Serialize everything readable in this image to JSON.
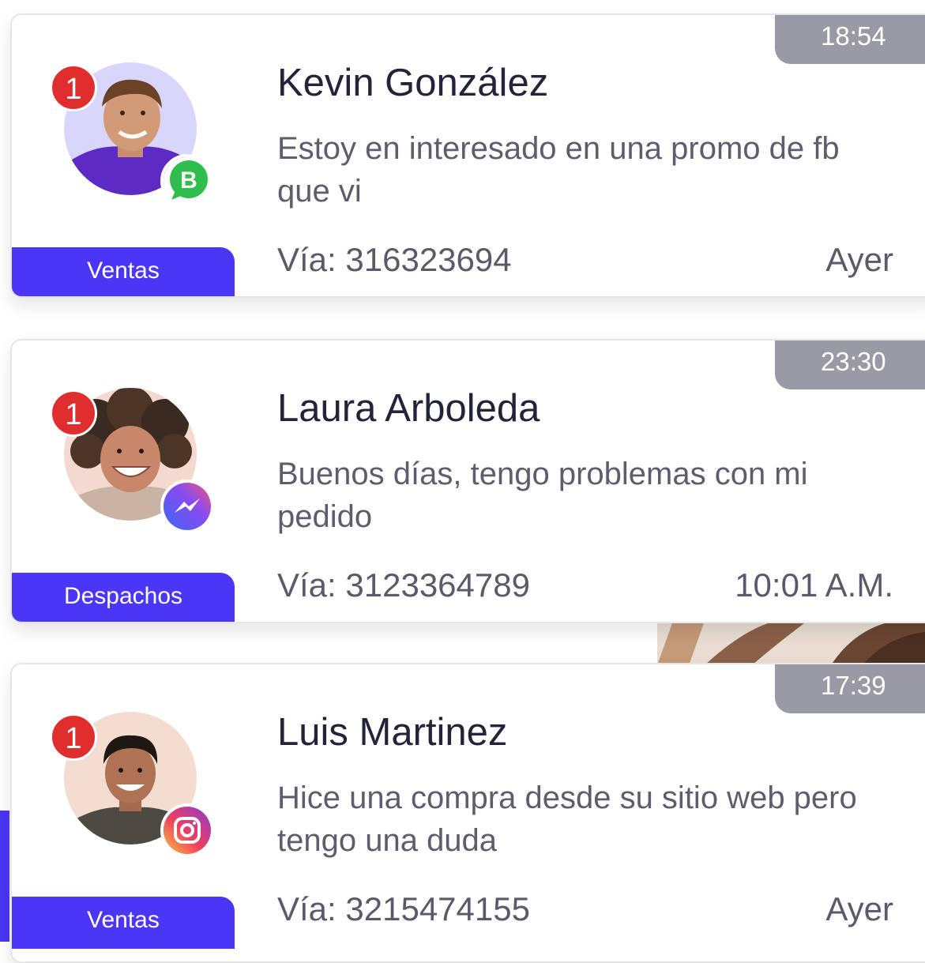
{
  "conversations": [
    {
      "time": "18:54",
      "unread": "1",
      "name": "Kevin González",
      "message": "Estoy en interesado en una promo de fb que vi",
      "via": "Vía: 316323694",
      "when": "Ayer",
      "department": "Ventas",
      "channel_icon": "whatsapp-business-icon",
      "channel_letter": "B",
      "channel_color": "#2fbe4b"
    },
    {
      "time": "23:30",
      "unread": "1",
      "name": "Laura Arboleda",
      "message": "Buenos días, tengo problemas con mi pedido",
      "via": "Vía: 3123364789",
      "when": "10:01 A.M.",
      "department": "Despachos",
      "channel_icon": "messenger-icon",
      "channel_color": "#4f6cf0"
    },
    {
      "time": "17:39",
      "unread": "1",
      "name": "Luis Martinez",
      "message": "Hice una compra desde su sitio web pero tengo una duda",
      "via": "Vía: 3215474155",
      "when": "Ayer",
      "department": "Ventas",
      "channel_icon": "instagram-icon",
      "channel_color": "#e1306c"
    }
  ],
  "colors": {
    "accent": "#4c36f5",
    "badge": "#e02d2d",
    "time_tab": "#9a9aa6"
  }
}
